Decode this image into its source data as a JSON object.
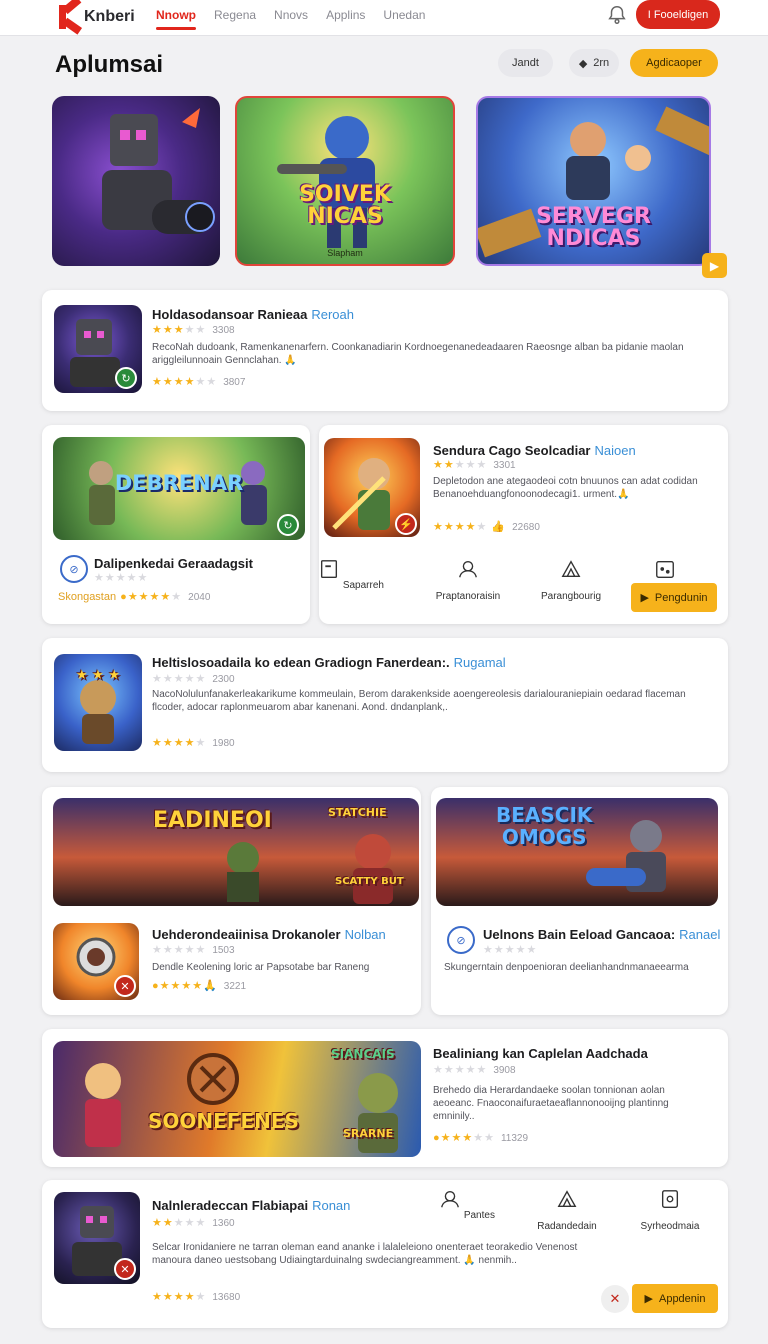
{
  "header": {
    "logo": "Knberi",
    "nav": [
      "Nnowp",
      "Regena",
      "Nnovs",
      "Applins",
      "Unedan"
    ],
    "cta": "I Fooeldigen"
  },
  "page": {
    "title": "Aplumsai",
    "pill_left": "Jandt",
    "pill_mid": "2rn",
    "pill_right": "Agdicaoper"
  },
  "heroes": [
    {
      "title": "",
      "sub": ""
    },
    {
      "title": "SOIVEK\nNICAS",
      "sub": "Slapham"
    },
    {
      "title": "SERVEGR\nNDICAS",
      "sub": ""
    }
  ],
  "cards": {
    "c1": {
      "title": "Holdasodansoar Ranieaa",
      "tag": "Reroah",
      "count_a": "3308",
      "desc": "RecoNah dudoank, Ramenkanenarfern. Coonkanadiarin Kordnoegenanedeadaaren Raeosnge alban ba pidanie maolan ariggleilunnoain Gennclahan. 🙏",
      "count_b": "3807"
    },
    "c2": {
      "banner": "DEBRENAR",
      "title": "Dalipenkedai Geraadagsit",
      "footer_label": "Skongastan",
      "count": "2040"
    },
    "c3": {
      "title": "Sendura Cago Seolcadiar",
      "tag": "Naioen",
      "count_a": "3301",
      "desc": "Depletodon ane ategaodeoi cotn bnuunos can adat codidan Benanoehduangfonoonodecagi1. urment.🙏",
      "count_b": "22680",
      "actions": [
        "Saparreh",
        "Praptanoraisin",
        "Parangbourig"
      ],
      "button": "Pengdunin"
    },
    "c4": {
      "title": "Heltislosoadaila ko edean Gradiogn Fanerdean:.",
      "tag": "Rugamal",
      "count_a": "2300",
      "desc": "NacoNolulunfanakerleakarikume kommeulain, Berom darakenkside aoengereolesis darialouraniepiain oedarad flaceman flcoder, adocar raplonmeuarom abar kanenani. Aond. dndanplank,.",
      "count_b": "1980"
    },
    "c5": {
      "banner_a": "EADINEOI",
      "banner_b": "STATCHIE",
      "banner_c": "SCATTY BUT",
      "title": "Uehderondeaiinisa Drokanoler",
      "tag": "Nolban",
      "count_a": "1503",
      "desc": "Dendle Keolening loric ar Papsotabe bar Raneng",
      "count_b": "3221"
    },
    "c6": {
      "banner": "BEASCIK\nOMOGS",
      "title": "Uelnons Bain Eeload Gancaoa:",
      "tag": "Ranael",
      "desc": "Skungerntain denpoenioran deelianhandnmanaeearma"
    },
    "c7": {
      "banner_a": "SOONEFENES",
      "banner_b": "SIANCAIS",
      "banner_c": "SRARNE",
      "title": "Bealiniang kan Caplelan Aadchada",
      "count_a": "3908",
      "desc": "Brehedo dia Herardandaeke soolan tonnionan aolan aeoeanc. Fnaoconaifuraetaeaflannonooijng plantinng emninily..",
      "count_b": "11329"
    },
    "c8": {
      "title": "Nalnleradeccan Flabiapai",
      "tag": "Ronan",
      "count_a": "1360",
      "desc": "Selcar Ironidaniere ne tarran oleman eand ananke i lalaleleiono onenteraet teorakedio Venenost manoura daneo uestsobang Udiaingtarduinalng swdeciangreamment. 🙏 nenmih..",
      "count_b": "13680",
      "actions": [
        "Pantes",
        "Radandedain",
        "Syrheodmaia"
      ],
      "button": "Appdenin"
    }
  },
  "colors": {
    "brand_red": "#e1261c",
    "accent_yellow": "#f6b21b",
    "tag_blue": "#3a8fd6"
  }
}
